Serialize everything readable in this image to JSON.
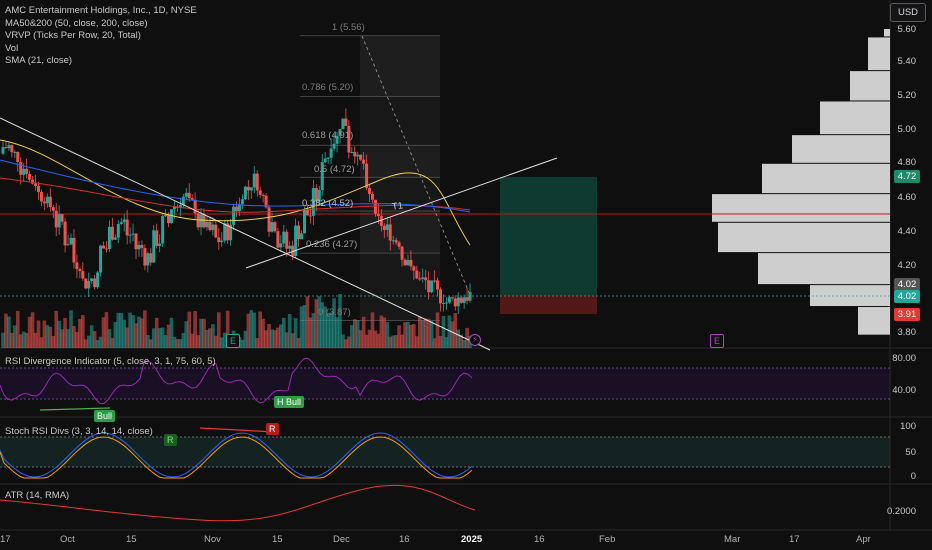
{
  "header": {
    "title": "AMC Entertainment Holdings, Inc., 1D, NYSE",
    "indicators": [
      "MA50&200 (50, close, 200, close)",
      "VRVP (Ticks Per Row, 20, Total)",
      "Vol",
      "SMA (21, close)"
    ],
    "currency_button": "USD"
  },
  "price_axis": {
    "labels": [
      "5.60",
      "5.40",
      "5.20",
      "5.00",
      "4.80",
      "4.60",
      "4.40",
      "4.20",
      "3.80"
    ],
    "tags": [
      {
        "value": "4.72",
        "color": "#1f8a6a"
      },
      {
        "value": "4.02",
        "color": "#555555"
      },
      {
        "value": "4.02",
        "color": "#26a69a"
      },
      {
        "value": "3.91",
        "color": "#e53935"
      }
    ]
  },
  "fib_labels": [
    "1 (5.56)",
    "0.786 (5.20)",
    "0.618 (4.91)",
    "0.5 (4.72)",
    "0.382 (4.52)",
    "0.236 (4.27)",
    "0 (3.87)"
  ],
  "trend_label": "T1",
  "earnings_markers": [
    "E",
    "E"
  ],
  "rsi_pane": {
    "title": "RSI Divergence Indicator (5, close, 3, 1, 75, 60, 5)",
    "axis": [
      "80.00",
      "40.00"
    ],
    "badges": [
      "Bull",
      "H Bull"
    ]
  },
  "stoch_pane": {
    "title": "Stoch RSI Divs (3, 3, 14, 14, close)",
    "axis": [
      "100",
      "50",
      "0"
    ],
    "badges": [
      "R",
      "R"
    ]
  },
  "atr_pane": {
    "title": "ATR (14, RMA)",
    "axis": [
      "0.2000"
    ]
  },
  "time_axis": [
    {
      "label": "17",
      "bold": false
    },
    {
      "label": "Oct",
      "bold": false
    },
    {
      "label": "15",
      "bold": false
    },
    {
      "label": "Nov",
      "bold": false
    },
    {
      "label": "15",
      "bold": false
    },
    {
      "label": "Dec",
      "bold": false
    },
    {
      "label": "16",
      "bold": false
    },
    {
      "label": "2025",
      "bold": true
    },
    {
      "label": "16",
      "bold": false
    },
    {
      "label": "Feb",
      "bold": false
    },
    {
      "label": "Mar",
      "bold": false
    },
    {
      "label": "17",
      "bold": false
    },
    {
      "label": "Apr",
      "bold": false
    }
  ],
  "colors": {
    "up": "#26a69a",
    "down": "#ef5350",
    "background": "#0f0f0f",
    "rsi": "#9c27b0",
    "stoch_k": "#2962ff",
    "stoch_d": "#ff9800",
    "atr": "#e53935",
    "sma": "#f0d03a",
    "ma200": "#d32f2f",
    "ma50": "#2962ff"
  }
}
